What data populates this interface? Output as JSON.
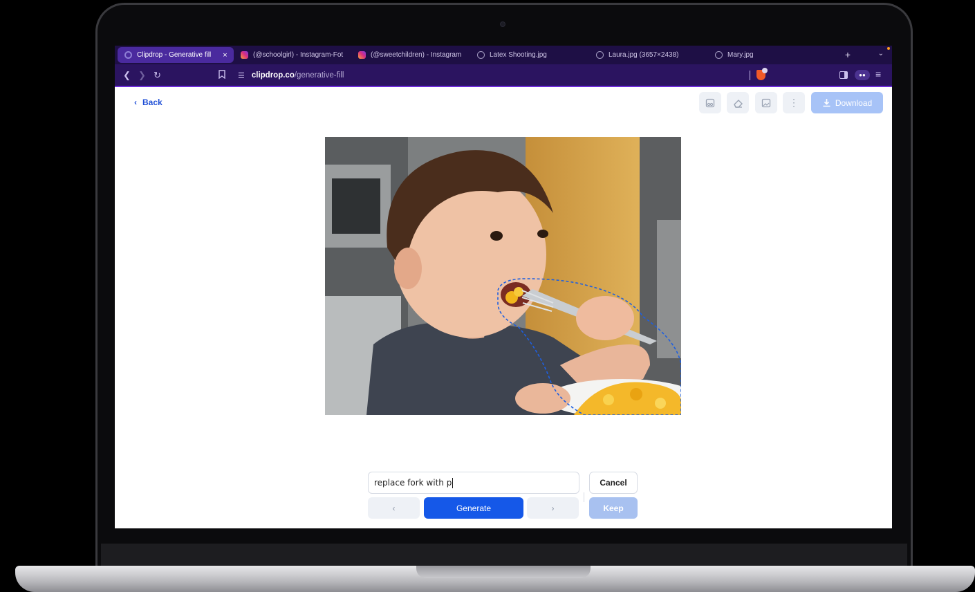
{
  "browser": {
    "tabs": [
      {
        "label": "Clipdrop - Generative fill",
        "icon": "clipdrop-icon"
      },
      {
        "label": "(@schoolgirl) - Instagram-Fot",
        "icon": "instagram-icon"
      },
      {
        "label": "(@sweetchildren) - Instagram",
        "icon": "instagram-icon"
      },
      {
        "label": "Latex Shooting.jpg",
        "icon": "globe-icon"
      },
      {
        "label": "Laura.jpg (3657×2438)",
        "icon": "globe-icon"
      },
      {
        "label": "Mary.jpg",
        "icon": "globe-icon"
      }
    ],
    "close_tab": "×",
    "new_tab": "+",
    "tab_list": "⌄",
    "url_host": "clipdrop.co",
    "url_path": "/generative-fill",
    "accent": "#6c2bd9"
  },
  "toolbar": {
    "back_label": "Back",
    "download_label": "Download"
  },
  "prompt": {
    "value": "replace fork with p",
    "cancel_label": "Cancel",
    "generate_label": "Generate",
    "keep_label": "Keep",
    "prev_label": "‹",
    "next_label": "›"
  },
  "colors": {
    "primary": "#1558e8",
    "selection_outline": "#1e5fe0"
  }
}
